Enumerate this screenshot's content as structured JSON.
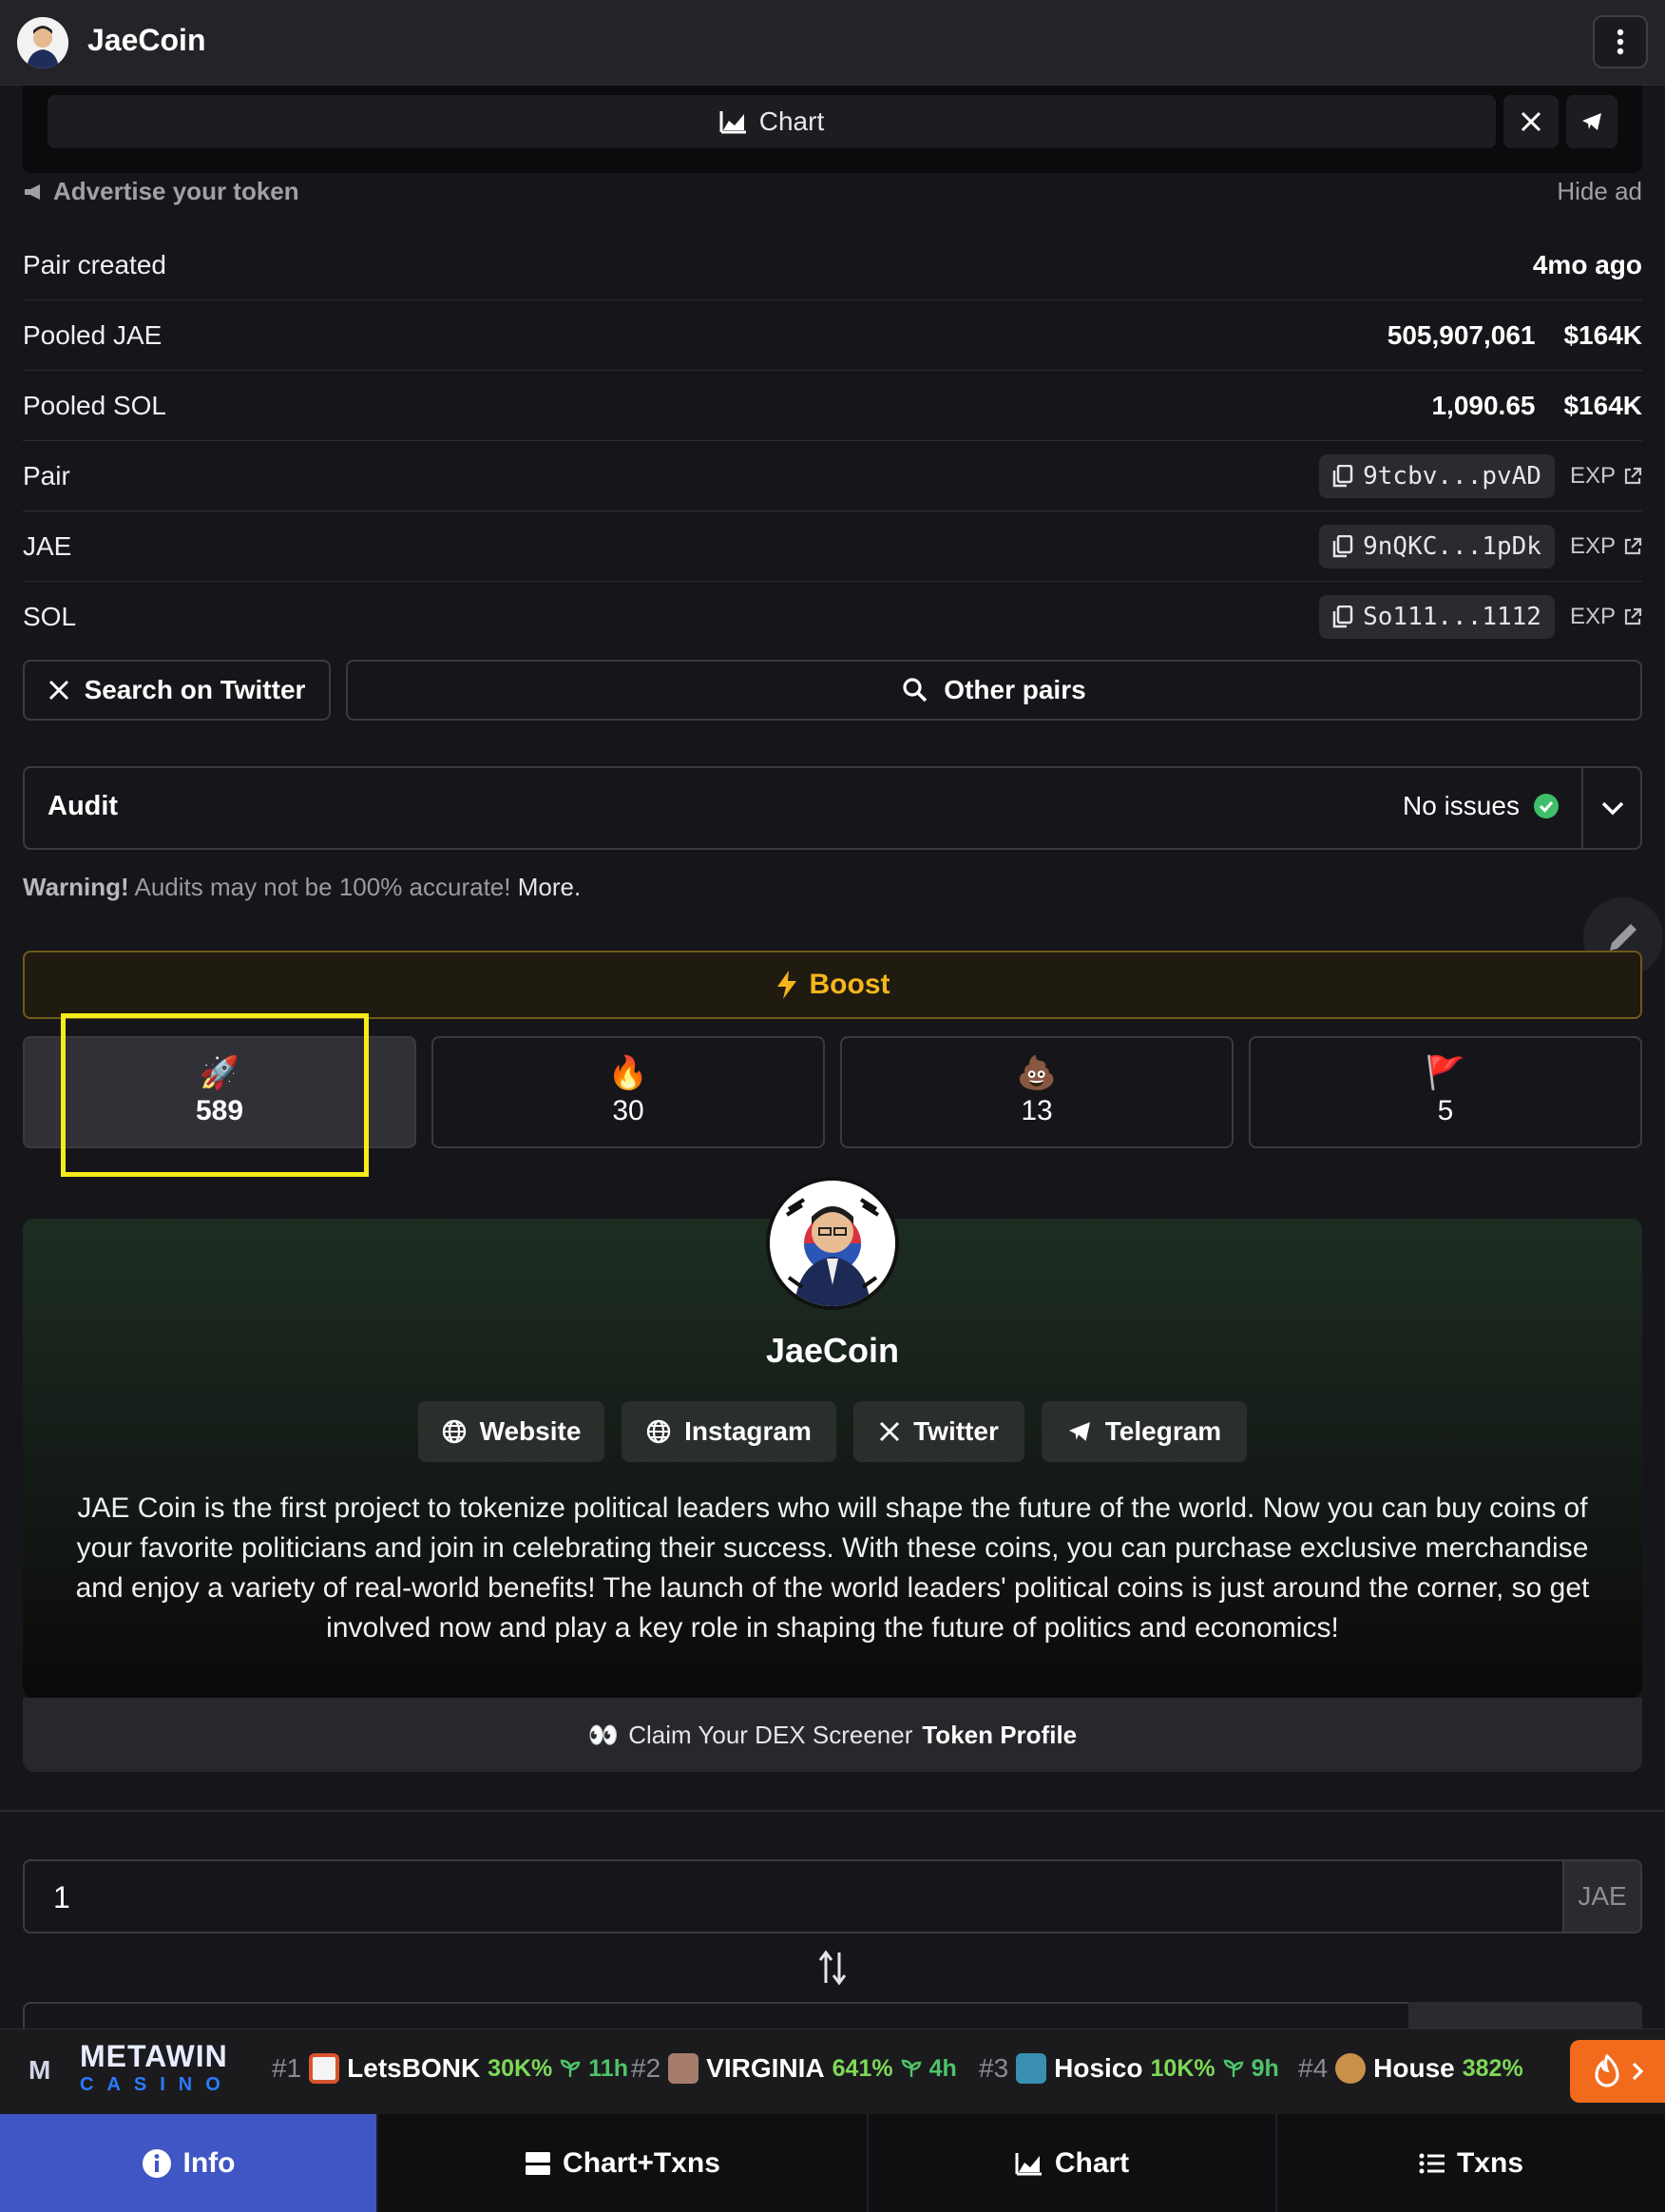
{
  "header": {
    "title": "JaeCoin",
    "menu_icon": "kebab-menu-icon"
  },
  "ad": {
    "chart_label": "Chart",
    "advertise_label": "Advertise your token",
    "hide_label": "Hide ad"
  },
  "info_rows": {
    "pair_created": {
      "label": "Pair created",
      "value": "4mo ago"
    },
    "pooled_jae": {
      "label": "Pooled JAE",
      "amount": "505,907,061",
      "usd": "$164K"
    },
    "pooled_sol": {
      "label": "Pooled SOL",
      "amount": "1,090.65",
      "usd": "$164K"
    },
    "pair": {
      "label": "Pair",
      "address": "9tcbv...pvAD",
      "exp": "EXP"
    },
    "jae": {
      "label": "JAE",
      "address": "9nQKC...1pDk",
      "exp": "EXP"
    },
    "sol": {
      "label": "SOL",
      "address": "So111...1112",
      "exp": "EXP"
    }
  },
  "actions": {
    "search_twitter": "Search on Twitter",
    "other_pairs": "Other pairs"
  },
  "audit": {
    "title": "Audit",
    "status": "No issues",
    "warning_bold": "Warning!",
    "warning_text": " Audits may not be 100% accurate! ",
    "more": "More."
  },
  "boost": {
    "label": "Boost"
  },
  "reactions": [
    {
      "emoji": "🚀",
      "count": "589"
    },
    {
      "emoji": "🔥",
      "count": "30"
    },
    {
      "emoji": "💩",
      "count": "13"
    },
    {
      "emoji": "🚩",
      "count": "5"
    }
  ],
  "profile": {
    "name": "JaeCoin",
    "links": {
      "website": "Website",
      "instagram": "Instagram",
      "twitter": "Twitter",
      "telegram": "Telegram"
    },
    "description": "JAE Coin is the first project to tokenize political leaders who will shape the future of the world. Now you can buy coins of your favorite politicians and join in celebrating their success. With these coins, you can purchase exclusive merchandise and enjoy a variety of real-world benefits! The launch of the world leaders' political coins is just around the corner, so get involved now and play a key role in shaping the future of politics and economics!"
  },
  "claim": {
    "prefix": "Claim Your DEX Screener ",
    "bold": "Token Profile",
    "icon": "👀"
  },
  "swap": {
    "value": "1",
    "unit": "JAE"
  },
  "ticker": {
    "brand_mark": "M",
    "brand": "METAWIN",
    "brand_sub": "CASINO",
    "items": [
      {
        "rank": "#1",
        "name": "LetsBONK",
        "pct": "30K%",
        "age": "11h",
        "color": "#f4f4f4"
      },
      {
        "rank": "#2",
        "name": "VIRGINIA",
        "pct": "641%",
        "age": "4h",
        "color": "#a67c6a"
      },
      {
        "rank": "#3",
        "name": "Hosico",
        "pct": "10K%",
        "age": "9h",
        "color": "#3a8fb0"
      },
      {
        "rank": "#4",
        "name": "House",
        "pct": "382%",
        "age": "",
        "color": "#c9904a"
      }
    ]
  },
  "nav": {
    "info": "Info",
    "chart_txns": "Chart+Txns",
    "chart": "Chart",
    "txns": "Txns"
  }
}
